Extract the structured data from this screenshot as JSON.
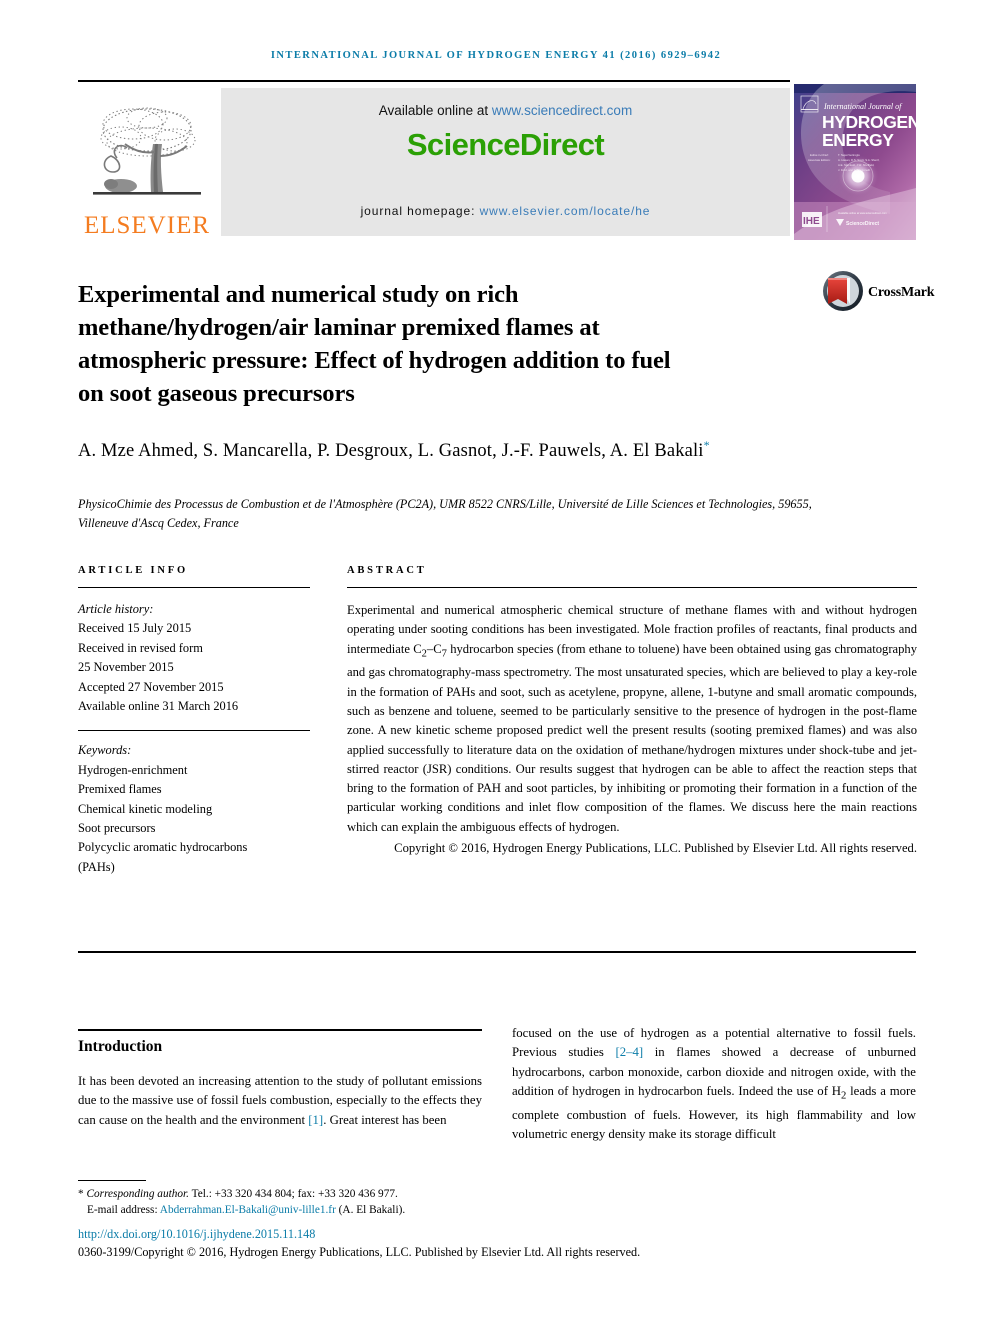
{
  "running_head": "International Journal of Hydrogen Energy 41 (2016) 6929–6942",
  "masthead": {
    "available_prefix": "Available online at ",
    "available_url": "www.sciencedirect.com",
    "brand": "ScienceDirect",
    "brand_color": "#2ba005",
    "homepage_prefix": "journal homepage: ",
    "homepage_url": "www.elsevier.com/locate/he",
    "publisher": "ELSEVIER",
    "publisher_color": "#f47c20",
    "tree_icon": "elsevier-tree-icon"
  },
  "cover": {
    "line1": "International Journal of",
    "line2": "HYDROGEN",
    "line3": "ENERGY",
    "editor_label": "Editor-in-Chief:",
    "editor_name": "T. Nejat Veziroğlu",
    "assoc_label": "Associate Editors:",
    "assoc_names": "A. Hasan, D.S. Scott, S.A. Sherif,\nA.E. Steinfeld, J.W. Sheffield,\nJ. Ford, and E.F. Antonelli",
    "footer_note": "Available online at www.sciencedirect.com",
    "footer_brand": "ScienceDirect",
    "ihe_mark": "ihe-logo-icon"
  },
  "crossmark": {
    "label": "CrossMark",
    "icon": "crossmark-icon"
  },
  "article": {
    "title": "Experimental and numerical study on rich methane/hydrogen/air laminar premixed flames at atmospheric pressure: Effect of hydrogen addition to fuel on soot gaseous precursors",
    "authors": "A. Mze Ahmed, S. Mancarella, P. Desgroux, L. Gasnot, J.-F. Pauwels, A. El Bakali",
    "corresponding_marker": "*",
    "affiliation": "PhysicoChimie des Processus de Combustion et de l'Atmosphère (PC2A), UMR 8522 CNRS/Lille, Université de Lille Sciences et Technologies, 59655, Villeneuve d'Ascq Cedex, France"
  },
  "info": {
    "heading": "ARTICLE INFO",
    "history_label": "Article history:",
    "history": [
      "Received 15 July 2015",
      "Received in revised form",
      "25 November 2015",
      "Accepted 27 November 2015",
      "Available online 31 March 2016"
    ],
    "keywords_label": "Keywords:",
    "keywords": [
      "Hydrogen-enrichment",
      "Premixed flames",
      "Chemical kinetic modeling",
      "Soot precursors",
      "Polycyclic aromatic hydrocarbons",
      "(PAHs)"
    ]
  },
  "abstract": {
    "heading": "ABSTRACT",
    "body_part1": "Experimental and numerical atmospheric chemical structure of methane flames with and without hydrogen operating under sooting conditions has been investigated. Mole fraction profiles of reactants, final products and intermediate C",
    "sub1": "2",
    "mid1": "–C",
    "sub2": "7",
    "body_part2": " hydrocarbon species (from ethane to toluene) have been obtained using gas chromatography and gas chromatography-mass spectrometry. The most unsaturated species, which are believed to play a key-role in the formation of PAHs and soot, such as acetylene, propyne, allene, 1-butyne and small aromatic compounds, such as benzene and toluene, seemed to be particularly sensitive to the presence of hydrogen in the post-flame zone. A new kinetic scheme proposed predict well the present results (sooting premixed flames) and was also applied successfully to literature data on the oxidation of methane/hydrogen mixtures under shock-tube and jet-stirred reactor (JSR) conditions. Our results suggest that hydrogen can be able to affect the reaction steps that bring to the formation of PAH and soot particles, by inhibiting or promoting their formation in a function of the particular working conditions and inlet flow composition of the flames. We discuss here the main reactions which can explain the ambiguous effects of hydrogen.",
    "copyright": "Copyright © 2016, Hydrogen Energy Publications, LLC. Published by Elsevier Ltd. All rights reserved."
  },
  "body": {
    "intro_heading": "Introduction",
    "left_part1": "It has been devoted an increasing attention to the study of pollutant emissions due to the massive use of fossil fuels combustion, especially to the effects they can cause on the health and the environment ",
    "left_ref1": "[1]",
    "left_part2": ". Great interest has been",
    "right_part1": "focused on the use of hydrogen as a potential alternative to fossil fuels. Previous studies ",
    "right_ref1": "[2–4]",
    "right_part2": " in flames showed a decrease of unburned hydrocarbons, carbon monoxide, carbon dioxide and nitrogen oxide, with the addition of hydrogen in hydrocarbon fuels. Indeed the use of H",
    "right_sub": "2",
    "right_part3": " leads a more complete combustion of fuels. However, its high flammability and low volumetric energy density make its storage difficult"
  },
  "footer": {
    "marker": "*",
    "corresponding_label": "Corresponding author.",
    "contact": " Tel.: +33 320 434 804; fax: +33 320 436 977.",
    "email_label": "E-mail address: ",
    "email": "Abderrahman.El-Bakali@univ-lille1.fr",
    "email_suffix": " (A. El Bakali).",
    "doi": "http://dx.doi.org/10.1016/j.ijhydene.2015.11.148",
    "issn_line": "0360-3199/Copyright © 2016, Hydrogen Energy Publications, LLC. Published by Elsevier Ltd. All rights reserved."
  }
}
